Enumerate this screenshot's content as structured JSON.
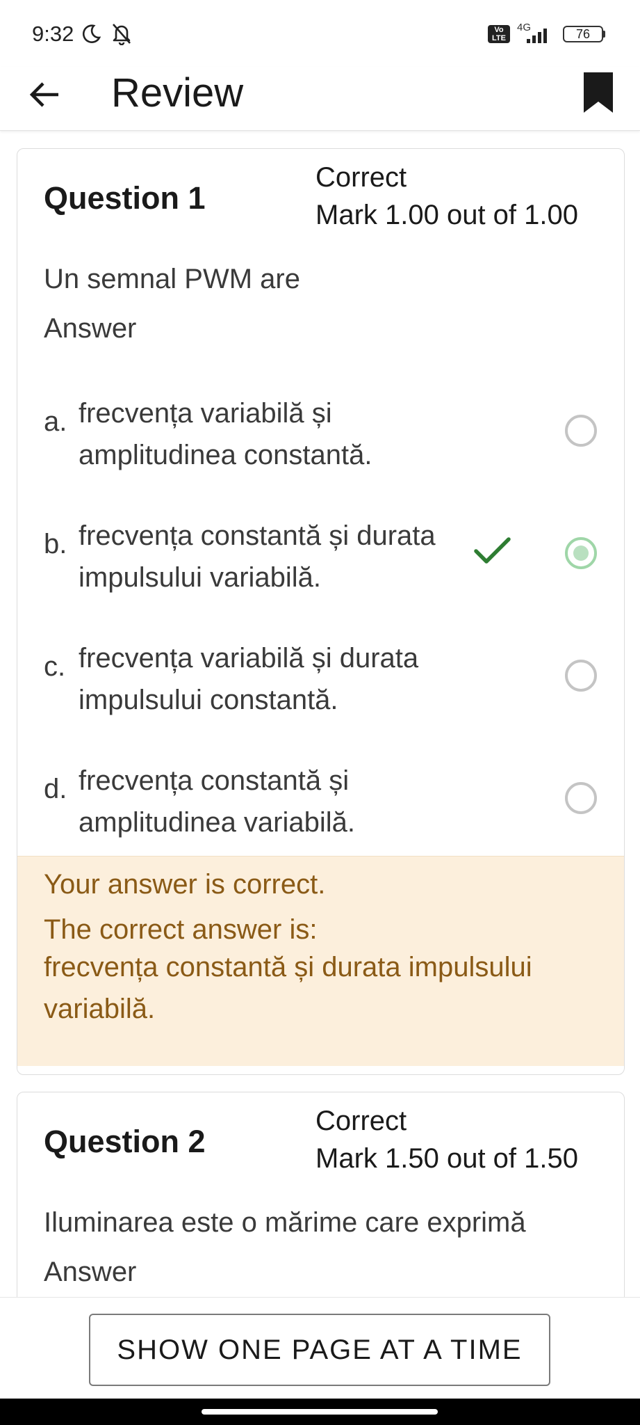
{
  "status_bar": {
    "time": "9:32",
    "volte_label": "Vo LTE",
    "network": "4G",
    "battery": "76",
    "icons": [
      "moon-icon",
      "bell-off-icon",
      "signal-icon"
    ]
  },
  "app_bar": {
    "title": "Review",
    "icons": [
      "back-arrow-icon",
      "bookmark-icon"
    ]
  },
  "questions": [
    {
      "title": "Question 1",
      "state": "Correct",
      "mark": "Mark 1.00 out of 1.00",
      "text": "Un semnal PWM are",
      "answer_label": "Answer",
      "options": [
        {
          "letter": "a.",
          "text": "frecvența variabilă și amplitudinea constantă.",
          "selected": false
        },
        {
          "letter": "b.",
          "text": "frecvența constantă și durata impulsului variabilă.",
          "selected": true,
          "correct_mark": "check-icon"
        },
        {
          "letter": "c.",
          "text": "frecvența variabilă și durata impulsului constantă.",
          "selected": false
        },
        {
          "letter": "d.",
          "text": "frecvența constantă și amplitudinea variabilă.",
          "selected": false
        }
      ],
      "feedback": {
        "line1": "Your answer is correct.",
        "line2": "The correct answer is:",
        "line3": "frecvența constantă și durata impulsului",
        "line4": "variabilă."
      }
    },
    {
      "title": "Question 2",
      "state": "Correct",
      "mark": "Mark 1.50 out of 1.50",
      "text": "Iluminarea este o mărime care exprimă",
      "answer_label": "Answer"
    }
  ],
  "footer": {
    "button_label": "SHOW ONE PAGE AT A TIME"
  },
  "colors": {
    "feedback_bg": "#fcefdc",
    "feedback_text": "#8a5a16",
    "check": "#2e7d32",
    "radio_selected": "#b9e0c0"
  }
}
